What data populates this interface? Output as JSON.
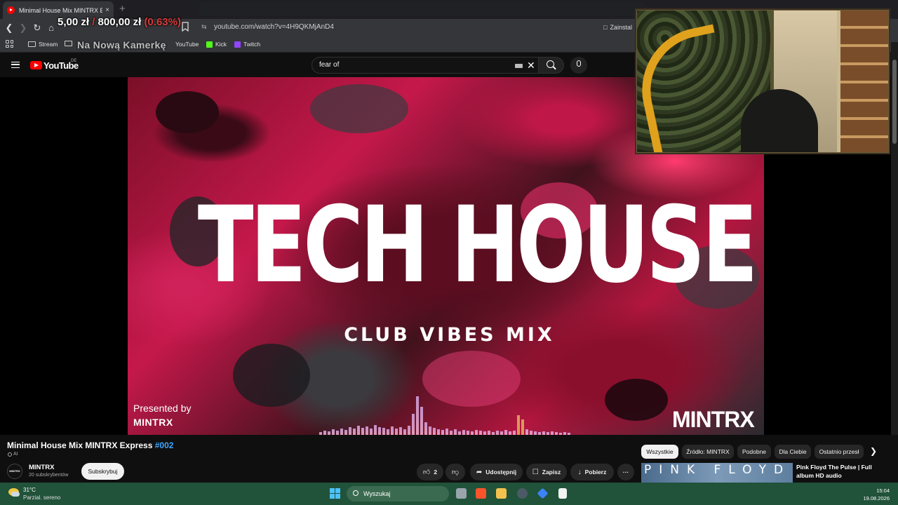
{
  "browser": {
    "tab_title": "Minimal House Mix MINTRX Express",
    "tab_close": "×",
    "new_tab": "+",
    "url": "youtube.com/watch?v=4H9QKMjAnD4",
    "install_label": "Zainstal",
    "bookmarks": [
      "Stream",
      "YouTube",
      "Kick",
      "Twitch"
    ]
  },
  "overlay": {
    "donation_current": "5,00 zł",
    "donation_sep": "/",
    "donation_goal": "800,00 zł",
    "donation_pct": "(0.63%)",
    "goal_label": "Na Nową Kamerkę"
  },
  "youtube": {
    "logo": "YouTube",
    "region": "DE",
    "search_value": "fear of",
    "clear": "✕"
  },
  "video": {
    "main_title": "TECH HOUSE",
    "subtitle": "CLUB VIBES MIX",
    "presented_by": "Presented by",
    "presenter": "MINTRX",
    "watermark": "MINTRX"
  },
  "watch": {
    "title": "Minimal House Mix MINTRX Express",
    "title_tag": "#002",
    "ai_label": "AI",
    "channel": "MINTRX",
    "channel_avatar": "MINTRX",
    "subscribers": "20 subskrybentów",
    "subscribe": "Subskrybuj",
    "likes": "2",
    "share": "Udostępnij",
    "save": "Zapisz",
    "download": "Pobierz",
    "more": "···"
  },
  "chips": [
    "Wszystkie",
    "Źródło: MINTRX",
    "Podobne",
    "Dla Ciebie",
    "Ostatnio przesł"
  ],
  "recommendation": {
    "thumb_text": "PINK FLOYD",
    "title": "Pink Floyd The Pulse | Full album HD audio"
  },
  "taskbar": {
    "temperature": "31°C",
    "condition": "Parzial. sereno",
    "search_placeholder": "Wyszukaj",
    "time": "15:04",
    "date": "19.08.2026"
  },
  "colors": {
    "youtube_red": "#ff0000",
    "link_blue": "#3ea6ff",
    "taskbar_green": "#21523a",
    "donation_red": "#d83a3a"
  }
}
